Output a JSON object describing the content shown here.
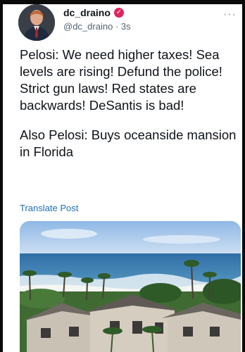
{
  "tweet": {
    "display_name": "dc_draino",
    "verified_icon": "verified-badge-icon",
    "handle": "@dc_draino",
    "separator": "·",
    "time_ago": "3s",
    "more_label": "···",
    "paragraph_1": "Pelosi: We need higher taxes! Sea levels are rising! Defund the police! Strict gun laws! Red states are backwards! DeSantis is bad!",
    "paragraph_2": "Also Pelosi: Buys oceanside mansion in Florida",
    "translate_label": "Translate Post"
  },
  "colors": {
    "link": "#1d6fb8",
    "muted": "#536471",
    "verified": "#e0245e"
  }
}
